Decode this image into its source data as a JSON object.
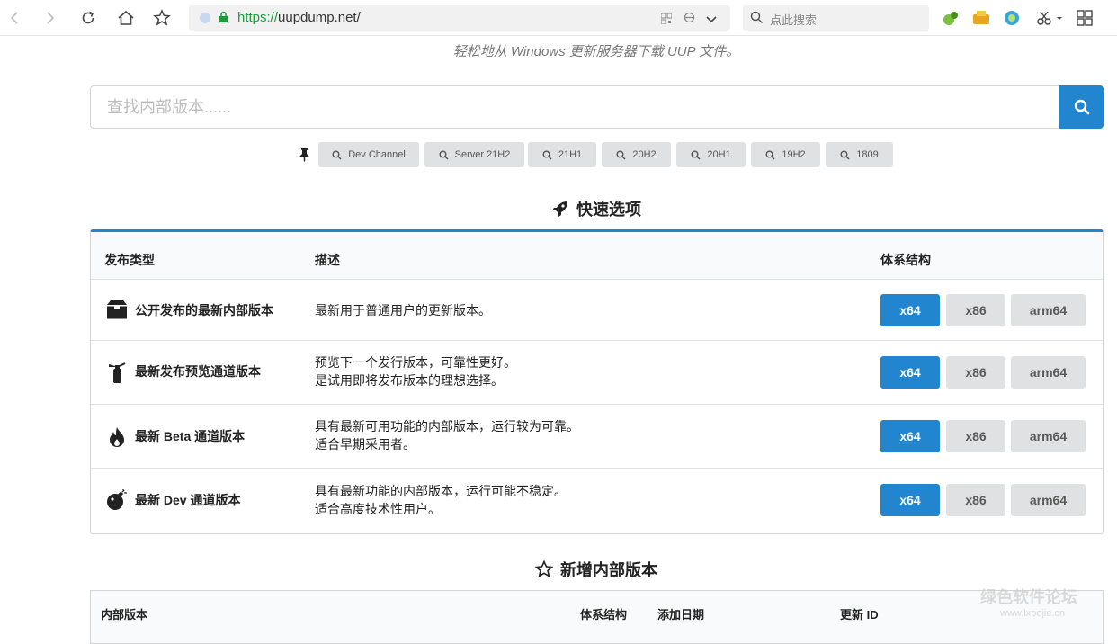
{
  "browser": {
    "url_protocol": "https://",
    "url_host": "uupdump.net/",
    "search_placeholder": "点此搜索"
  },
  "page": {
    "subtitle": "轻松地从 Windows 更新服务器下载 UUP 文件。",
    "search_placeholder": "查找内部版本......",
    "quick_tags": [
      "Dev Channel",
      "Server 21H2",
      "21H1",
      "20H2",
      "20H1",
      "19H2",
      "1809"
    ]
  },
  "quick_options": {
    "title": "快速选项",
    "headers": {
      "type": "发布类型",
      "description": "描述",
      "arch": "体系结构"
    },
    "rows": [
      {
        "name": "公开发布的最新内部版本",
        "icon": "box-icon",
        "desc1": "最新用于普通用户的更新版本。",
        "desc2": ""
      },
      {
        "name": "最新发布预览通道版本",
        "icon": "fire-extinguisher-icon",
        "desc1": "预览下一个发行版本，可靠性更好。",
        "desc2": "是试用即将发布版本的理想选择。"
      },
      {
        "name": "最新 Beta 通道版本",
        "icon": "fire-icon",
        "desc1": "具有最新可用功能的内部版本，运行较为可靠。",
        "desc2": "适合早期采用者。"
      },
      {
        "name": "最新 Dev 通道版本",
        "icon": "bomb-icon",
        "desc1": "具有最新功能的内部版本，运行可能不稳定。",
        "desc2": "适合高度技术性用户。"
      }
    ],
    "arch_buttons": [
      "x64",
      "x86",
      "arm64"
    ]
  },
  "new_builds": {
    "title": "新增内部版本",
    "headers": {
      "build": "内部版本",
      "arch": "体系结构",
      "date": "添加日期",
      "update_id": "更新 ID"
    }
  },
  "watermark": {
    "main": "绿色软件论坛",
    "sub": "www.lxpojie.cn"
  },
  "colors": {
    "primary": "#2185d0",
    "grey_button": "#e0e1e2",
    "url_green": "#1a9c3c"
  }
}
